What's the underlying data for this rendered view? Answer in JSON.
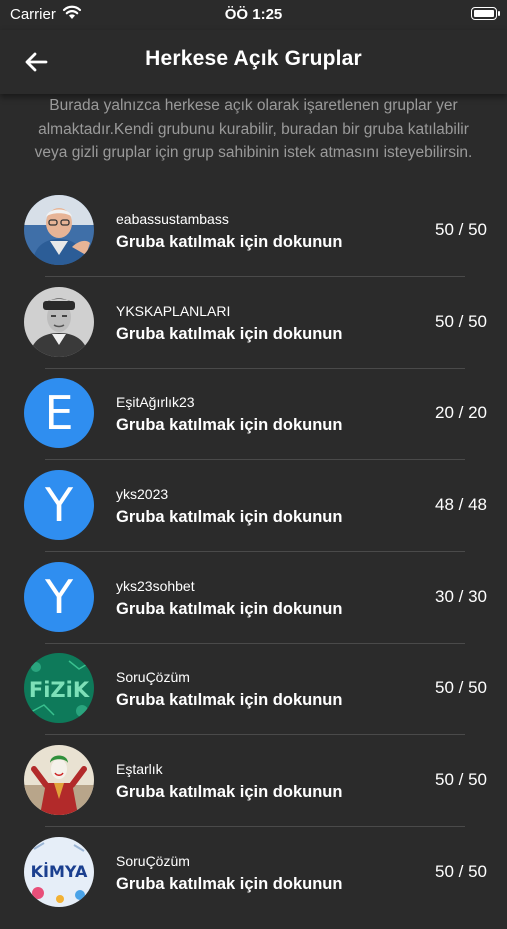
{
  "status_bar": {
    "carrier": "Carrier",
    "time": "ÖÖ 1:25"
  },
  "nav": {
    "title": "Herkese Açık Gruplar"
  },
  "description": "Burada yalnızca herkese açık olarak işaretlenen gruplar yer almaktadır.Kendi grubunu kurabilir, buradan bir gruba katılabilir veya gizli gruplar için grup sahibinin istek atmasını isteyebilirsin.",
  "groups": [
    {
      "name": "eabassustambass",
      "action": "Gruba katılmak için dokunun",
      "count": "50 / 50",
      "avatar": "photo-man"
    },
    {
      "name": "YKSKAPLANLARI",
      "action": "Gruba katılmak için dokunun",
      "count": "50 / 50",
      "avatar": "photo-portrait"
    },
    {
      "name": "EşitAğırlık23",
      "action": "Gruba katılmak için dokunun",
      "count": "20 / 20",
      "avatar_letter": "E"
    },
    {
      "name": "yks2023",
      "action": "Gruba katılmak için dokunun",
      "count": "48 / 48",
      "avatar_letter": "Y"
    },
    {
      "name": "yks23sohbet",
      "action": "Gruba katılmak için dokunun",
      "count": "30 / 30",
      "avatar_letter": "Y"
    },
    {
      "name": "SoruÇözüm",
      "action": "Gruba katılmak için dokunun",
      "count": "50 / 50",
      "avatar": "fizik-logo",
      "avatar_text": "FiZiK"
    },
    {
      "name": "Eştarlık",
      "action": "Gruba katılmak için dokunun",
      "count": "50 / 50",
      "avatar": "joker-image"
    },
    {
      "name": "SoruÇözüm",
      "action": "Gruba katılmak için dokunun",
      "count": "50 / 50",
      "avatar": "kimya-logo",
      "avatar_text": "KİMYA"
    }
  ],
  "colors": {
    "background": "#2b2b2b",
    "avatar_blue": "#2f8ef0",
    "description_text": "#9a9a9a"
  }
}
